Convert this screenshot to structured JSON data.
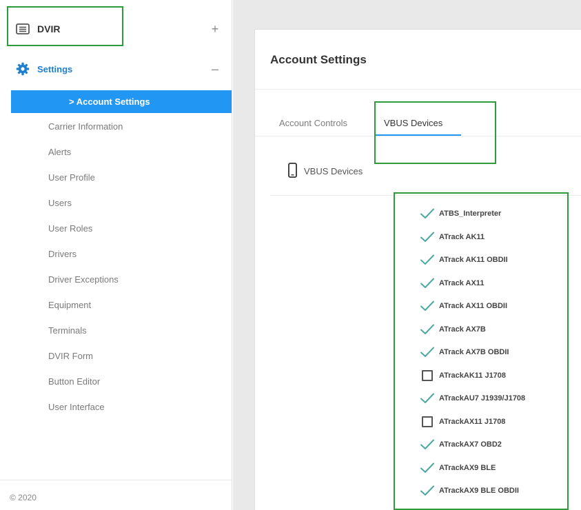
{
  "sidebar": {
    "dvir": {
      "label": "DVIR",
      "toggle": "+"
    },
    "settings": {
      "label": "Settings",
      "toggle": "–"
    },
    "active_item": "> Account Settings",
    "items": [
      "Carrier Information",
      "Alerts",
      "User Profile",
      "Users",
      "User Roles",
      "Drivers",
      "Driver Exceptions",
      "Equipment",
      "Terminals",
      "DVIR Form",
      "Button Editor",
      "User Interface"
    ],
    "footer": "© 2020"
  },
  "main": {
    "title": "Account Settings",
    "tabs": [
      {
        "label": "Account Controls",
        "active": false
      },
      {
        "label": "VBUS Devices",
        "active": true
      }
    ],
    "section_label": "VBUS Devices",
    "devices": [
      {
        "name": "ATBS_Interpreter",
        "checked": true
      },
      {
        "name": "ATrack AK11",
        "checked": true
      },
      {
        "name": "ATrack AK11 OBDII",
        "checked": true
      },
      {
        "name": "ATrack AX11",
        "checked": true
      },
      {
        "name": "ATrack AX11 OBDII",
        "checked": true
      },
      {
        "name": "ATrack AX7B",
        "checked": true
      },
      {
        "name": "ATrack AX7B OBDII",
        "checked": true
      },
      {
        "name": "ATrackAK11 J1708",
        "checked": false
      },
      {
        "name": "ATrackAU7 J1939/J1708",
        "checked": true
      },
      {
        "name": "ATrackAX11 J1708",
        "checked": false
      },
      {
        "name": "ATrackAX7 OBD2",
        "checked": true
      },
      {
        "name": "ATrackAX9 BLE",
        "checked": true
      },
      {
        "name": "ATrackAX9 BLE OBDII",
        "checked": true
      }
    ]
  },
  "colors": {
    "accent": "#2196f3",
    "check": "#4aa9a0",
    "highlight": "#2e9b3b"
  },
  "icons": {
    "dvir": "list-icon",
    "settings": "gear-icon",
    "section": "phone-icon",
    "checked": "checkmark-icon",
    "unchecked": "checkbox-icon"
  }
}
